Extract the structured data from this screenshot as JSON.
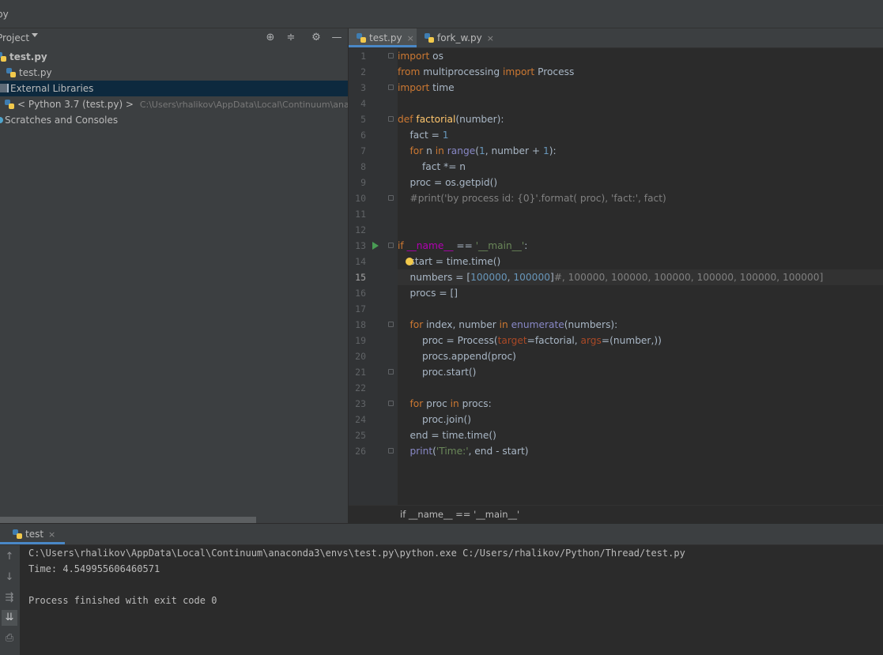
{
  "window": {
    "title": "py"
  },
  "project_panel": {
    "header_label": "Project",
    "tree": [
      {
        "label": "test.py",
        "bold": true
      },
      {
        "label": "test.py"
      },
      {
        "label": "External Libraries"
      },
      {
        "label": "< Python 3.7 (test.py) >",
        "detail": "C:\\Users\\rhalikov\\AppData\\Local\\Continuum\\anaconda"
      },
      {
        "label": "Scratches and Consoles"
      }
    ]
  },
  "editor": {
    "tabs": [
      {
        "label": "test.py",
        "active": true,
        "close": "×"
      },
      {
        "label": "fork_w.py",
        "active": false,
        "close": "×"
      }
    ],
    "current_line": 15,
    "lines": [
      "import os",
      "from multiprocessing import Process",
      "import time",
      "",
      "def factorial(number):",
      "    fact = 1",
      "    for n in range(1, number + 1):",
      "        fact *= n",
      "    proc = os.getpid()",
      "    #print('by process id: {0}'.format( proc), 'fact:', fact)",
      "",
      "",
      "if __name__ == '__main__':",
      "    start = time.time()",
      "    numbers = [100000, 100000]#, 100000, 100000, 100000, 100000, 100000, 100000]",
      "    procs = []",
      "",
      "    for index, number in enumerate(numbers):",
      "        proc = Process(target=factorial, args=(number,))",
      "        procs.append(proc)",
      "        proc.start()",
      "",
      "    for proc in procs:",
      "        proc.join()",
      "    end = time.time()",
      "    print('Time:', end - start)"
    ],
    "breadcrumb": "if __name__ == '__main__'"
  },
  "run_panel": {
    "tab_label": "test",
    "tab_close": "×",
    "console_lines": [
      "C:\\Users\\rhalikov\\AppData\\Local\\Continuum\\anaconda3\\envs\\test.py\\python.exe C:/Users/rhalikov/Python/Thread/test.py",
      "Time: 4.549955606460571",
      "",
      "Process finished with exit code 0"
    ]
  },
  "icons": {
    "locate": "⊕",
    "collapse": "≑",
    "settings": "⚙",
    "hide": "—",
    "up": "↑",
    "down": "↓",
    "wrap": "⇶",
    "scroll_end": "⇊",
    "print": "⎙"
  },
  "colors": {
    "keyword": "#cc7832",
    "number": "#6897bb",
    "string": "#6a8759",
    "function": "#ffc66d",
    "accent": "#4a88c7"
  }
}
